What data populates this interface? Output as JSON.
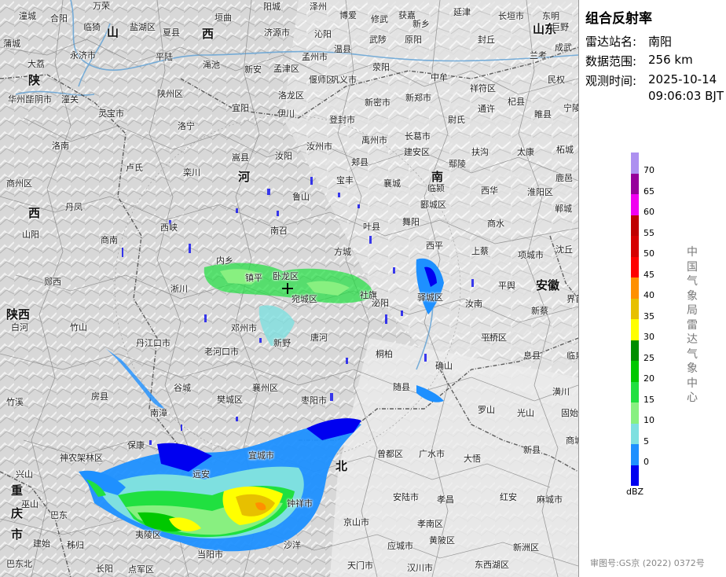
{
  "panel": {
    "title": "组合反射率",
    "station_label": "雷达站名:",
    "station_value": "南阳",
    "range_label": "数据范围:",
    "range_value": "256 km",
    "time_label": "观测时间:",
    "time_date": "2025-10-14",
    "time_clock": "09:06:03 BJT",
    "unit": "dBZ",
    "vertical_text": "中国气象局雷达气象中心",
    "approval": "审图号:GS京 (2022) 0372号"
  },
  "legend": [
    {
      "label": "70",
      "color": "#ad90f0"
    },
    {
      "label": "65",
      "color": "#96009b"
    },
    {
      "label": "60",
      "color": "#f000f0"
    },
    {
      "label": "55",
      "color": "#c00000"
    },
    {
      "label": "50",
      "color": "#d60000"
    },
    {
      "label": "45",
      "color": "#ff0000"
    },
    {
      "label": "40",
      "color": "#ff9000"
    },
    {
      "label": "35",
      "color": "#e7c000"
    },
    {
      "label": "30",
      "color": "#ffff00"
    },
    {
      "label": "25",
      "color": "#008e00"
    },
    {
      "label": "20",
      "color": "#00c800"
    },
    {
      "label": "15",
      "color": "#20e040"
    },
    {
      "label": "10",
      "color": "#88f080"
    },
    {
      "label": "5",
      "color": "#7ee0e0"
    },
    {
      "label": "0",
      "color": "#1e90ff"
    },
    {
      "label": "",
      "color": "#0000f0"
    }
  ],
  "map": {
    "provinces": [
      {
        "name": "山",
        "key": "shanxi1"
      },
      {
        "name": "西",
        "key": "shanxi2"
      },
      {
        "name": "陕",
        "key": "shaanxi1"
      },
      {
        "name": "河",
        "key": "henan1"
      },
      {
        "name": "南",
        "key": "henan2"
      },
      {
        "name": "西",
        "key": "shaanxi2"
      },
      {
        "name": "陕西",
        "key": "shaanxi3"
      },
      {
        "name": "山东",
        "key": "shandong"
      },
      {
        "name": "安徽",
        "key": "anhui"
      },
      {
        "name": "北",
        "key": "hubei"
      },
      {
        "name": "重",
        "key": "cq1"
      },
      {
        "name": "庆",
        "key": "cq2"
      },
      {
        "name": "市",
        "key": "cq3"
      }
    ],
    "places": [
      "潼城",
      "合阳",
      "万荣",
      "盐湖区",
      "垣曲",
      "阳城",
      "泽州",
      "博爱",
      "修武",
      "获嘉",
      "新乡",
      "延津",
      "长垣市",
      "东明",
      "巨野",
      "蒲城",
      "临猗",
      "山",
      "夏县",
      "西",
      "济源市",
      "沁阳",
      "温县",
      "武陟",
      "原阳",
      "封丘",
      "兰考",
      "成武",
      "大荔",
      "永济市",
      "平陆",
      "渑池",
      "新安",
      "孟津区",
      "孟州市",
      "荥阳",
      "中牟",
      "祥符区",
      "杞县",
      "民权",
      "华州区",
      "华阴市",
      "潼关",
      "陕州区",
      "宜阳",
      "洛龙区",
      "偃师区",
      "巩义市",
      "新密市",
      "新郑市",
      "通许",
      "睢县",
      "宁陵",
      "灵宝市",
      "伊川",
      "登封市",
      "尉氏",
      "洛宁",
      "汝州市",
      "禹州市",
      "长葛市",
      "扶沟",
      "太康",
      "柘城",
      "洛南",
      "嵩县",
      "汝阳",
      "建安区",
      "鄢陵",
      "西华",
      "淮阳区",
      "鹿邑",
      "卢氏",
      "栾川",
      "郏县",
      "宝丰",
      "襄城",
      "临颍",
      "郸城",
      "商州区",
      "鲁山",
      "叶县",
      "郾城区",
      "商水",
      "丹凤",
      "西峡",
      "南召",
      "方城",
      "舞阳",
      "上蔡",
      "项城市",
      "沈丘",
      "山阳",
      "商南",
      "内乡",
      "镇平",
      "卧龙区",
      "宛城区",
      "社旗",
      "西平",
      "平舆",
      "新蔡",
      "界首",
      "郧西",
      "淅川",
      "邓州市",
      "新野",
      "唐河",
      "泌阳",
      "驿城区",
      "汝南",
      "正阳",
      "息县",
      "临泉",
      "白河",
      "竹山",
      "丹江口市",
      "老河口市",
      "桐柏",
      "确山",
      "平桥区",
      "潢川",
      "固始",
      "房县",
      "谷城",
      "樊城区",
      "襄州区",
      "枣阳市",
      "随县",
      "罗山",
      "光山",
      "商城",
      "竹溪",
      "保康",
      "南漳",
      "宜城市",
      "曾都区",
      "广水市",
      "大悟",
      "新县",
      "神农架林区",
      "钟祥市",
      "京山市",
      "安陆市",
      "孝昌",
      "红安",
      "麻城市",
      "兴山",
      "远安",
      "沙洋",
      "应城市",
      "孝南区",
      "黄陂区",
      "新洲区",
      "夷陵区",
      "当阳市",
      "天门市",
      "汉川市",
      "东西湖区",
      "巴东",
      "秭归",
      "点军区",
      "巫山",
      "建始",
      "巴东北",
      "长阳"
    ]
  }
}
